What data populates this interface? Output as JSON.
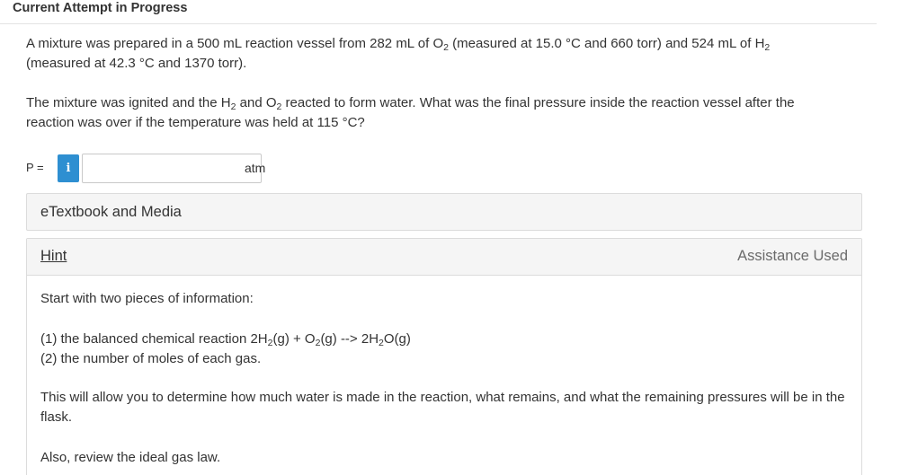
{
  "header": {
    "title": "Current Attempt in Progress"
  },
  "question": {
    "p1_a": "A mixture was prepared in a 500 mL reaction vessel from 282 mL of O",
    "p1_b": " (measured at 15.0 °C and 660 torr) and 524 mL of H",
    "p1_c": "(measured at 42.3 °C and 1370 torr).",
    "p2_a": "The mixture was ignited and the H",
    "p2_b": " and O",
    "p2_c": " reacted to form water. What was the final pressure inside the reaction vessel after the reaction was over if the temperature was held at 115 °C?",
    "sub_2": "2"
  },
  "answer": {
    "label": "P =",
    "info_icon": "i",
    "value": "",
    "unit": "atm"
  },
  "etextbook": {
    "label": "eTextbook and Media"
  },
  "hint": {
    "link_label": "Hint",
    "status": "Assistance Used",
    "line1": "Start with two pieces of information:",
    "line2_a": "(1) the balanced chemical reaction 2H",
    "line2_b": "(g) + O",
    "line2_c": "(g) --> 2H",
    "line2_d": "O(g)",
    "line3": "(2) the number of moles of each gas.",
    "line4": "This will allow you to determine how much water is made in the reaction, what remains, and what the remaining pressures will be in the flask.",
    "line5": "Also, review the ideal gas law."
  },
  "colors": {
    "info_button": "#2e8fd1",
    "panel_bg": "#f5f5f5",
    "border": "#dcdcdc"
  }
}
